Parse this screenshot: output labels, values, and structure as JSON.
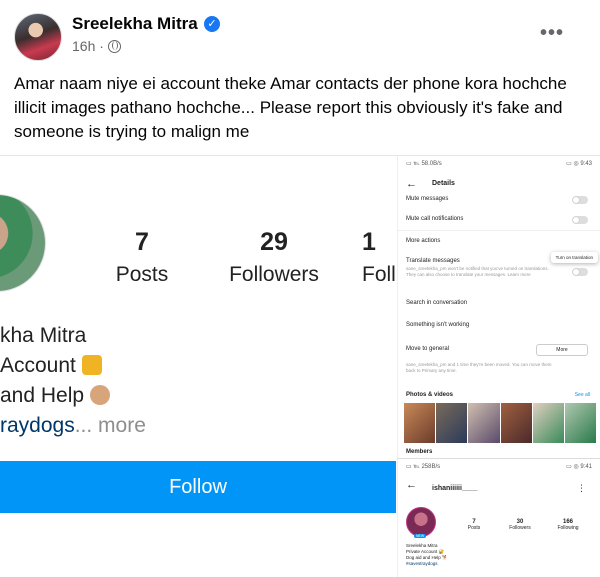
{
  "post": {
    "author": "Sreelekha Mitra",
    "verified_mark": "✓",
    "time": "16h ·",
    "audience_icon": "globe-icon",
    "text": "Amar naam niye ei account theke Amar contacts der phone kora hochche illicit images pathano hochche... Please report this obviously it's fake and someone is trying to malign me"
  },
  "instagram_left": {
    "stats": [
      {
        "num": "7",
        "label": "Posts"
      },
      {
        "num": "29",
        "label": "Followers"
      },
      {
        "num": "1",
        "label": "Foll"
      }
    ],
    "bio": {
      "name": "kha Mitra",
      "line2": "Account",
      "line3": "and Help",
      "link": "raydogs",
      "more": "... more"
    },
    "follow_label": "Follow"
  },
  "phone_top": {
    "status_left": "▭ ℡ 58.0B/s",
    "status_right": "▭ ◎ 9:43",
    "title": "Details",
    "rows": {
      "mute_messages": "Mute messages",
      "mute_calls": "Mute call notifications",
      "more_actions": "More actions",
      "translate": "Translate messages",
      "translate_sub": "sane_sreelekha_pm won't be notified that you've turned on translations. They can also choose to translate your messages. Learn more",
      "search": "Search in conversation",
      "something": "Something isn't working",
      "move_general": "Move to general",
      "move_sub": "sane_sreelekha_pm and 1 time they're been moved. You can move them back to Primary any time.",
      "photos": "Photos & videos",
      "members": "Members"
    },
    "tooltip": "Turn on translation",
    "more_btn": "More",
    "see_all": "See all"
  },
  "phone_bottom": {
    "status_left": "▭ ℡ 258B/s",
    "status_right": "▭ ◎ 9:41",
    "handle": "ishaniiiiii____",
    "new_badge": "NEW",
    "stats": [
      {
        "num": "7",
        "label": "Posts"
      },
      {
        "num": "30",
        "label": "Followers"
      },
      {
        "num": "166",
        "label": "Following"
      }
    ],
    "bio_lines": [
      "Sreelekha Mitra",
      "Private Account 🔐",
      "Dog aid and Help 🐕",
      "#savestraydogs"
    ]
  },
  "colors": {
    "facebook_blue": "#1877f2",
    "instagram_blue": "#0095f6",
    "meta_grey": "#65676b"
  }
}
